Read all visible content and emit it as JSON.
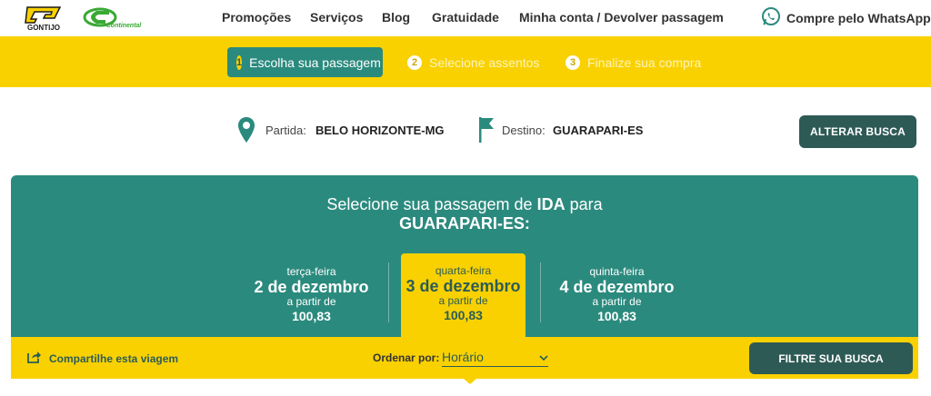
{
  "brand": {
    "logo_primary": "GONTIJO",
    "logo_secondary": "Continental",
    "colors": {
      "yellow": "#f9d100",
      "teal": "#2b8a7e",
      "dark_teal": "#2e5a56",
      "green_logo": "#3aa935"
    }
  },
  "nav": {
    "links": [
      "Promoções",
      "Serviços",
      "Blog",
      "Gratuidade",
      "Minha conta / Devolver passagem"
    ],
    "whatsapp_label": "Compre pelo WhatsApp",
    "whatsapp_icon": "whatsapp-icon"
  },
  "steps": [
    {
      "number": "1",
      "label": "Escolha sua passagem",
      "active": true
    },
    {
      "number": "2",
      "label": "Selecione assentos",
      "active": false
    },
    {
      "number": "3",
      "label": "Finalize sua compra",
      "active": false
    }
  ],
  "route": {
    "origin_label": "Partida:",
    "origin_value": "BELO HORIZONTE-MG",
    "origin_icon": "map-pin-icon",
    "destination_label": "Destino:",
    "destination_value": "GUARAPARI-ES",
    "destination_icon": "flag-icon",
    "change_button": "ALTERAR BUSCA"
  },
  "trip": {
    "title_prefix": "Selecione sua passagem de ",
    "title_direction": "IDA",
    "title_suffix": " para",
    "title_destination": "GUARAPARI-ES:"
  },
  "dates": [
    {
      "weekday": "terça-feira",
      "date": "2 de dezembro",
      "from_label": "a partir de",
      "price": "100,83",
      "selected": false
    },
    {
      "weekday": "quarta-feira",
      "date": "3 de dezembro",
      "from_label": "a partir de",
      "price": "100,83",
      "selected": true
    },
    {
      "weekday": "quinta-feira",
      "date": "4 de dezembro",
      "from_label": "a partir de",
      "price": "100,83",
      "selected": false
    }
  ],
  "filters": {
    "share_label": "Compartilhe esta viagem",
    "share_icon": "share-icon",
    "order_label": "Ordenar por:",
    "order_value": "Horário",
    "filter_button": "FILTRE SUA BUSCA"
  }
}
